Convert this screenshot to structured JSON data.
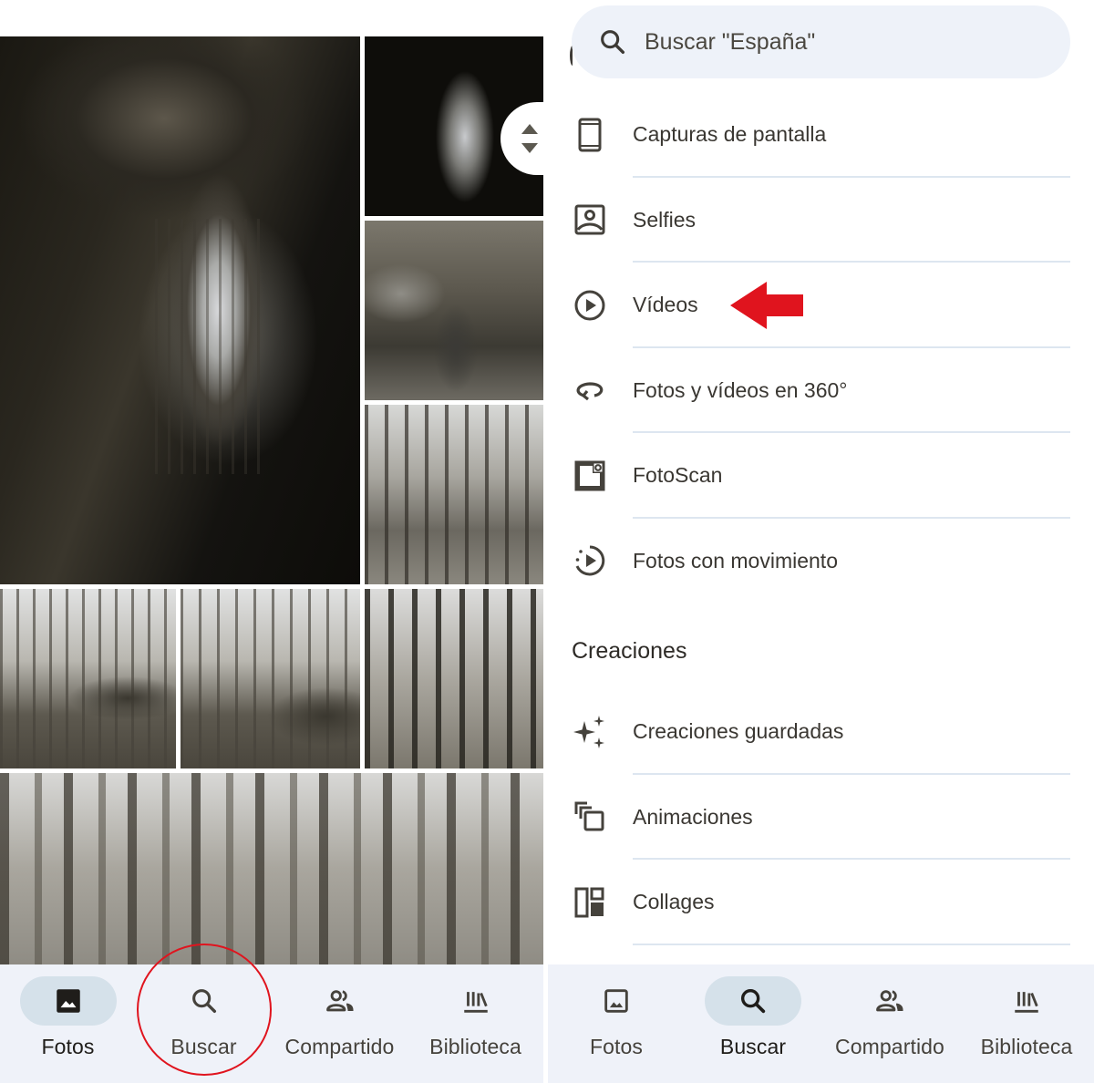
{
  "left_screen": {
    "photos": [
      {
        "name": "photo-tree-hollow-large",
        "desc": "Hollow tree trunk interior looking out to forest"
      },
      {
        "name": "photo-dark-tree-hollow",
        "desc": "Dark tree hollow"
      },
      {
        "name": "photo-person-in-tree",
        "desc": "Person standing inside hollow tree"
      },
      {
        "name": "photo-forest-person",
        "desc": "Person walking in forest"
      },
      {
        "name": "photo-forest-rocks-1",
        "desc": "Forest with rocks"
      },
      {
        "name": "photo-forest-rocks-2",
        "desc": "Forest with rocks and person"
      },
      {
        "name": "photo-forest-trunks",
        "desc": "Forest tree trunks"
      },
      {
        "name": "photo-forest-wide",
        "desc": "Wide forest trees"
      }
    ],
    "nav": {
      "items": [
        {
          "label": "Fotos",
          "icon": "photo-icon",
          "active": true
        },
        {
          "label": "Buscar",
          "icon": "search-icon",
          "active": false,
          "highlighted": true
        },
        {
          "label": "Compartido",
          "icon": "people-icon",
          "active": false
        },
        {
          "label": "Biblioteca",
          "icon": "library-icon",
          "active": false
        }
      ]
    },
    "annotation_color": "#e0141e"
  },
  "right_screen": {
    "search": {
      "placeholder": "Buscar \"España\"",
      "icon": "search-icon"
    },
    "categories": [
      {
        "label": "Capturas de pantalla",
        "icon": "smartphone-icon"
      },
      {
        "label": "Selfies",
        "icon": "portrait-icon"
      },
      {
        "label": "Vídeos",
        "icon": "play-circle-icon",
        "annotated": true
      },
      {
        "label": "Fotos y vídeos en 360°",
        "icon": "rotate-360-icon"
      },
      {
        "label": "FotoScan",
        "icon": "photoscan-icon"
      },
      {
        "label": "Fotos con movimiento",
        "icon": "motion-photo-icon"
      }
    ],
    "creations_title": "Creaciones",
    "creations": [
      {
        "label": "Creaciones guardadas",
        "icon": "sparkle-icon"
      },
      {
        "label": "Animaciones",
        "icon": "animation-icon"
      },
      {
        "label": "Collages",
        "icon": "collage-icon"
      }
    ],
    "nav": {
      "items": [
        {
          "label": "Fotos",
          "icon": "photo-icon",
          "active": false
        },
        {
          "label": "Buscar",
          "icon": "search-icon",
          "active": true
        },
        {
          "label": "Compartido",
          "icon": "people-icon",
          "active": false
        },
        {
          "label": "Biblioteca",
          "icon": "library-icon",
          "active": false
        }
      ]
    },
    "annotation_color": "#e0141e"
  }
}
